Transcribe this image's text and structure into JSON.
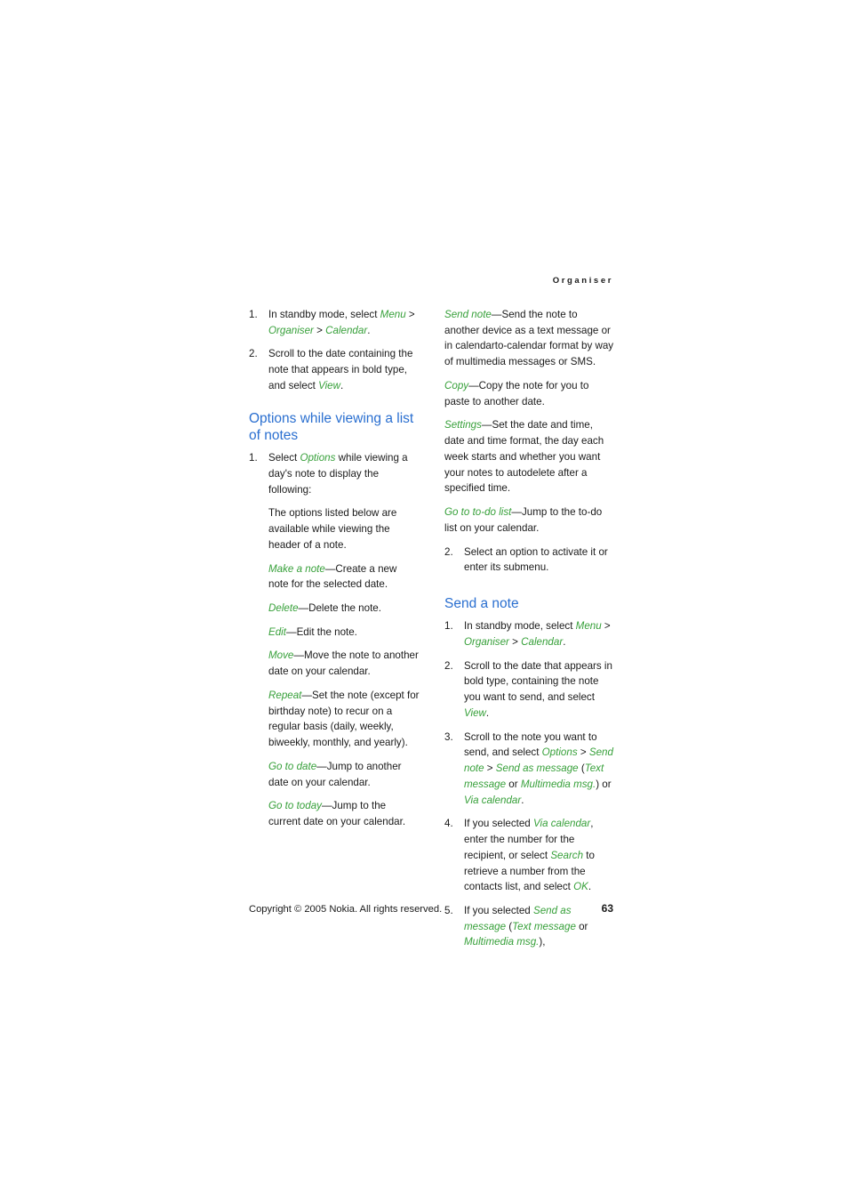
{
  "header": {
    "running_title": "Organiser"
  },
  "left_column": {
    "intro_steps": [
      {
        "num": "1.",
        "segments": [
          {
            "t": "plain",
            "v": "In standby mode, select "
          },
          {
            "t": "term",
            "v": "Menu"
          },
          {
            "t": "plain",
            "v": " > "
          },
          {
            "t": "term",
            "v": "Organiser"
          },
          {
            "t": "plain",
            "v": " > "
          },
          {
            "t": "term",
            "v": "Calendar"
          },
          {
            "t": "plain",
            "v": "."
          }
        ]
      },
      {
        "num": "2.",
        "segments": [
          {
            "t": "plain",
            "v": "Scroll to the date containing the note that appears in bold type, and select "
          },
          {
            "t": "term",
            "v": "View"
          },
          {
            "t": "plain",
            "v": "."
          }
        ]
      }
    ],
    "heading": "Options while viewing a list of notes",
    "step1": {
      "num": "1.",
      "segments": [
        {
          "t": "plain",
          "v": "Select "
        },
        {
          "t": "term",
          "v": "Options"
        },
        {
          "t": "plain",
          "v": " while viewing a day's note to display the following:"
        }
      ]
    },
    "step1_note": "The options listed below are available while viewing the header of a note.",
    "options": [
      {
        "term": "Make a note",
        "desc": "—Create a new note for the selected date."
      },
      {
        "term": "Delete",
        "desc": "—Delete the note."
      },
      {
        "term": "Edit",
        "desc": "—Edit the note."
      },
      {
        "term": "Move",
        "desc": "—Move the note to another date on your calendar."
      },
      {
        "term": "Repeat",
        "desc": "—Set the note (except for birthday note) to recur on a regular basis (daily, weekly, biweekly, monthly, and yearly)."
      },
      {
        "term": "Go to date",
        "desc": "—Jump to another date on your calendar."
      },
      {
        "term": "Go to today",
        "desc": "—Jump to the current date on your calendar."
      }
    ]
  },
  "right_column": {
    "options_continued": [
      {
        "term": "Send note",
        "desc": "—Send the note to another device as a text message or in calendarto-calendar format by way of multimedia messages or SMS."
      },
      {
        "term": "Copy",
        "desc": "—Copy the note for you to paste to another date."
      },
      {
        "term": "Settings",
        "desc": "—Set the date and time, date and time format, the day each week starts and whether you want your notes to autodelete after a specified time."
      },
      {
        "term": "Go to to-do list",
        "desc": "—Jump to the to-do list on your calendar."
      }
    ],
    "step2": {
      "num": "2.",
      "text": "Select an option to activate it or enter its submenu."
    },
    "heading": "Send a note",
    "send_steps": [
      {
        "num": "1.",
        "segments": [
          {
            "t": "plain",
            "v": "In standby mode, select "
          },
          {
            "t": "term",
            "v": "Menu"
          },
          {
            "t": "plain",
            "v": " > "
          },
          {
            "t": "term",
            "v": "Organiser"
          },
          {
            "t": "plain",
            "v": " > "
          },
          {
            "t": "term",
            "v": "Calendar"
          },
          {
            "t": "plain",
            "v": "."
          }
        ]
      },
      {
        "num": "2.",
        "segments": [
          {
            "t": "plain",
            "v": "Scroll to the date that appears in bold type, containing the note you want to send, and select "
          },
          {
            "t": "term",
            "v": "View"
          },
          {
            "t": "plain",
            "v": "."
          }
        ]
      },
      {
        "num": "3.",
        "segments": [
          {
            "t": "plain",
            "v": "Scroll to the note you want to send, and select "
          },
          {
            "t": "term",
            "v": "Options"
          },
          {
            "t": "plain",
            "v": " > "
          },
          {
            "t": "term",
            "v": "Send note"
          },
          {
            "t": "plain",
            "v": " > "
          },
          {
            "t": "term",
            "v": "Send as message"
          },
          {
            "t": "plain",
            "v": " ("
          },
          {
            "t": "term",
            "v": "Text message"
          },
          {
            "t": "plain",
            "v": " or "
          },
          {
            "t": "term",
            "v": "Multimedia msg."
          },
          {
            "t": "plain",
            "v": ") or "
          },
          {
            "t": "term",
            "v": "Via calendar"
          },
          {
            "t": "plain",
            "v": "."
          }
        ]
      },
      {
        "num": "4.",
        "segments": [
          {
            "t": "plain",
            "v": "If you selected "
          },
          {
            "t": "term",
            "v": "Via calendar"
          },
          {
            "t": "plain",
            "v": ", enter the number for the recipient, or select "
          },
          {
            "t": "term",
            "v": "Search"
          },
          {
            "t": "plain",
            "v": " to retrieve a number from the contacts list, and select "
          },
          {
            "t": "term",
            "v": "OK"
          },
          {
            "t": "plain",
            "v": "."
          }
        ]
      },
      {
        "num": "5.",
        "segments": [
          {
            "t": "plain",
            "v": "If you selected "
          },
          {
            "t": "term",
            "v": "Send as message"
          },
          {
            "t": "plain",
            "v": " ("
          },
          {
            "t": "term",
            "v": "Text message"
          },
          {
            "t": "plain",
            "v": " or "
          },
          {
            "t": "term",
            "v": "Multimedia msg."
          },
          {
            "t": "plain",
            "v": "),"
          }
        ]
      }
    ]
  },
  "footer": {
    "copyright": "Copyright © 2005 Nokia. All rights reserved.",
    "page_number": "63"
  },
  "colors": {
    "heading_blue": "#2a6fd0",
    "term_green": "#37a03a",
    "body_black": "#1a1a1a"
  }
}
